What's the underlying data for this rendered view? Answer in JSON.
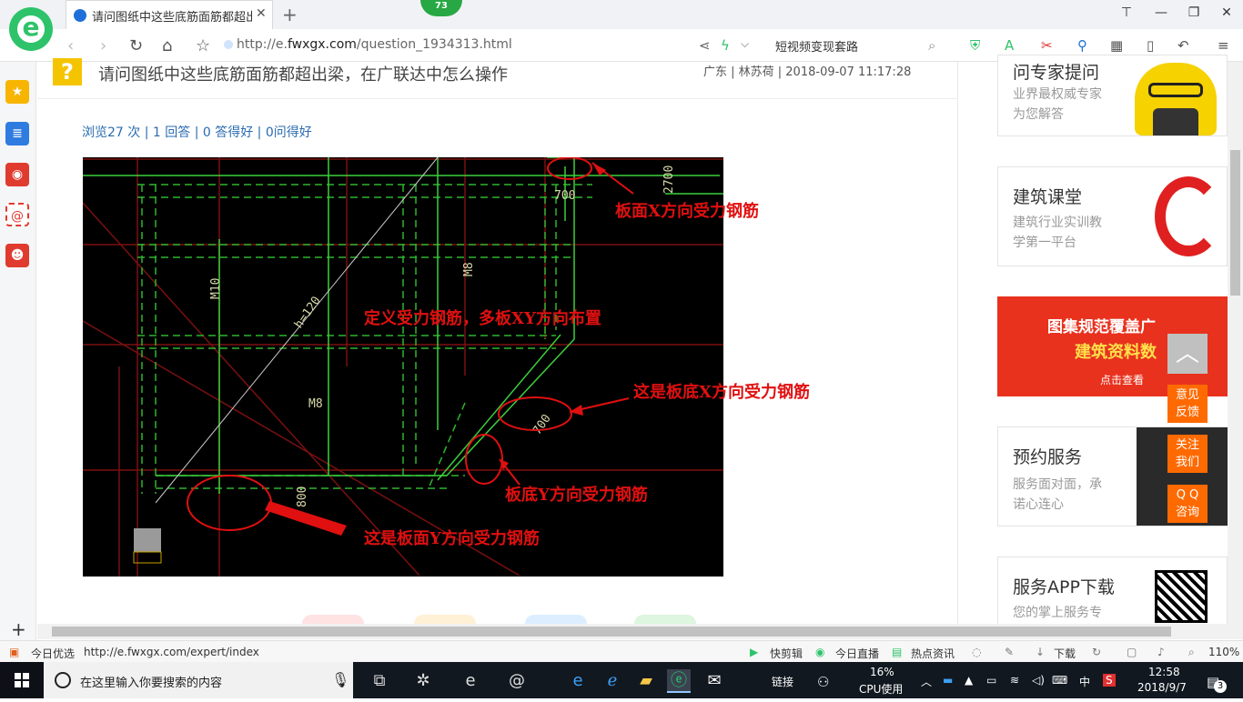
{
  "browser": {
    "tab_title": "请问图纸中这些底筋面筋都超出梁，在广联达中怎么操作",
    "badge": "73",
    "url_prefix": "http://e.",
    "url_domain": "fwxgx.com",
    "url_path": "/question_1934313.html",
    "search_text": "短视频变现套路"
  },
  "question": {
    "title": "请问图纸中这些底筋面筋都超出梁，在广联达中怎么操作",
    "meta": "广东 | 林苏荷 | 2018-09-07 11:17:28",
    "stats": "浏览27 次 | 1 回答 | 0 答得好 | 0问得好"
  },
  "cad": {
    "labels": {
      "m10": "M10",
      "m8_top": "M8",
      "m8_mid": "M8",
      "h120": "h=120",
      "d700a": "700",
      "d2700": "2700",
      "d700b": "700",
      "d800": "800"
    },
    "annotations": {
      "top_x": "板面X方向受力钢筋",
      "define": "定义受力钢筋，多板XY方向布置",
      "bottom_x": "这是板底X方向受力钢筋",
      "bottom_y": "板底Y方向受力钢筋",
      "top_y": "这是板面Y方向受力钢筋"
    }
  },
  "sidebar_cards": [
    {
      "title": "问专家提问",
      "sub1": "业界最权威专家",
      "sub2": "为您解答"
    },
    {
      "title": "建筑课堂",
      "sub1": "建筑行业实训教",
      "sub2": "学第一平台"
    },
    {
      "title": "图集规范覆盖广",
      "sub1": "建筑资料数",
      "sub2": "点击查看"
    },
    {
      "title": "预约服务",
      "sub1": "服务面对面，承",
      "sub2": "诺心连心"
    },
    {
      "title": "服务APP下载",
      "sub1": "您的掌上服务专",
      "sub2": ""
    }
  ],
  "float_buttons": {
    "feedback": "意见\n反馈",
    "follow": "关注\n我们",
    "qq": "Q Q\n咨询"
  },
  "statusbar": {
    "left_label": "今日优选",
    "link": "http://e.fwxgx.com/expert/index",
    "clip": "快剪辑",
    "live": "今日直播",
    "news": "热点资讯",
    "download": "下载",
    "zoom": "110%"
  },
  "taskbar": {
    "search_placeholder": "在这里输入你要搜索的内容",
    "link_label": "链接",
    "cpu_percent": "16%",
    "cpu_label": "CPU使用",
    "ime": "中",
    "time": "12:58",
    "date": "2018/9/7",
    "notif_count": "3"
  },
  "colors": {
    "accent_green": "#2ec36a",
    "annotation_red": "#e01010",
    "float_orange": "#ff6a00",
    "link_blue": "#2b6cb0"
  }
}
